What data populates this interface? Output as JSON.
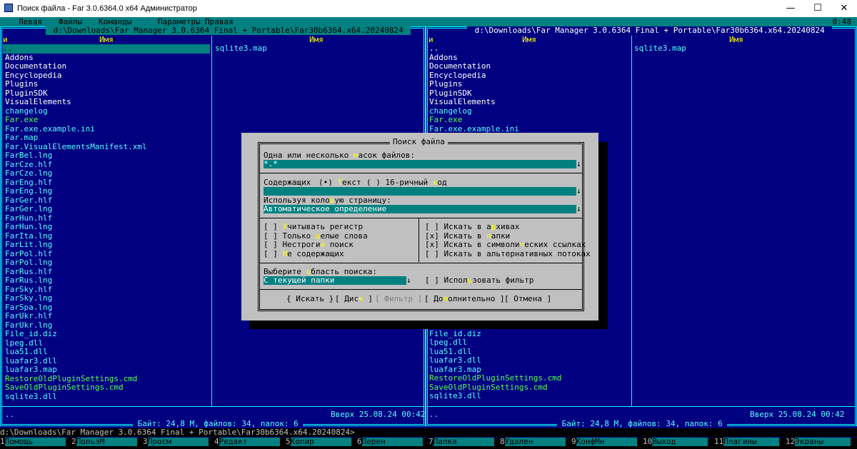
{
  "window": {
    "title": "Поиск файла - Far 3.0.6364.0 x64 Администратор",
    "controls": [
      "—",
      "☐",
      "✕"
    ]
  },
  "menu": {
    "items": [
      "Левая",
      "Файлы",
      "Команды",
      "Параметры",
      "Правая"
    ],
    "clock": "0:48"
  },
  "left_panel": {
    "path": " d:\\Downloads\\Far Manager 3.0.6364 Final + Portable\\Far30b6364.x64.20240824 ",
    "col_headers": [
      "и",
      "Имя",
      "Имя"
    ],
    "col1_selected": "..",
    "col1": [
      {
        "name": "Addons",
        "color": "#ffffff"
      },
      {
        "name": "Documentation",
        "color": "#ffffff"
      },
      {
        "name": "Encyclopedia",
        "color": "#ffffff"
      },
      {
        "name": "Plugins",
        "color": "#ffffff"
      },
      {
        "name": "PluginSDK",
        "color": "#ffffff"
      },
      {
        "name": "VisualElements",
        "color": "#ffffff"
      },
      {
        "name": "changelog",
        "color": "#55ffff"
      },
      {
        "name": "Far.exe",
        "color": "#55ff55"
      },
      {
        "name": "Far.exe.example.ini",
        "color": "#55ffff"
      },
      {
        "name": "Far.map",
        "color": "#55ffff"
      },
      {
        "name": "Far.VisualElementsManifest.xml",
        "color": "#55ffff"
      },
      {
        "name": "FarBel.lng",
        "color": "#55ffff"
      },
      {
        "name": "FarCze.hlf",
        "color": "#55ffff"
      },
      {
        "name": "FarCze.lng",
        "color": "#55ffff"
      },
      {
        "name": "FarEng.hlf",
        "color": "#55ffff"
      },
      {
        "name": "FarEng.lng",
        "color": "#55ffff"
      },
      {
        "name": "FarGer.hlf",
        "color": "#55ffff"
      },
      {
        "name": "FarGer.lng",
        "color": "#55ffff"
      },
      {
        "name": "FarHun.hlf",
        "color": "#55ffff"
      },
      {
        "name": "FarHun.lng",
        "color": "#55ffff"
      },
      {
        "name": "FarIta.lng",
        "color": "#55ffff"
      },
      {
        "name": "FarLit.lng",
        "color": "#55ffff"
      },
      {
        "name": "FarPol.hlf",
        "color": "#55ffff"
      },
      {
        "name": "FarPol.lng",
        "color": "#55ffff"
      },
      {
        "name": "FarRus.hlf",
        "color": "#55ffff"
      },
      {
        "name": "FarRus.lng",
        "color": "#55ffff"
      },
      {
        "name": "FarSky.hlf",
        "color": "#55ffff"
      },
      {
        "name": "FarSky.lng",
        "color": "#55ffff"
      },
      {
        "name": "FarSpa.lng",
        "color": "#55ffff"
      },
      {
        "name": "FarUkr.hlf",
        "color": "#55ffff"
      },
      {
        "name": "FarUkr.lng",
        "color": "#55ffff"
      },
      {
        "name": "File_id.diz",
        "color": "#55ffff"
      },
      {
        "name": "lpeg.dll",
        "color": "#55ffff"
      },
      {
        "name": "lua51.dll",
        "color": "#55ffff"
      },
      {
        "name": "luafar3.dll",
        "color": "#55ffff"
      },
      {
        "name": "luafar3.map",
        "color": "#55ffff"
      },
      {
        "name": "RestoreOldPluginSettings.cmd",
        "color": "#55ff55"
      },
      {
        "name": "SaveOldPluginSettings.cmd",
        "color": "#55ff55"
      },
      {
        "name": "sqlite3.dll",
        "color": "#55ffff"
      }
    ],
    "col2": [
      "sqlite3.map"
    ],
    "status_name": "..",
    "status_info": "Вверх 25.08.24 00:42",
    "info": " Байт: 24,8 М, файлов: 34, папок: 6 "
  },
  "right_panel": {
    "path": " d:\\Downloads\\Far Manager 3.0.6364 Final + Portable\\Far30b6364.x64.20240824 ",
    "col_headers": [
      "и",
      "Имя",
      "Имя"
    ],
    "col1_top": [
      {
        "name": "..",
        "color": "#ffffff"
      },
      {
        "name": "Addons",
        "color": "#ffffff"
      },
      {
        "name": "Documentation",
        "color": "#ffffff"
      },
      {
        "name": "Encyclopedia",
        "color": "#ffffff"
      },
      {
        "name": "Plugins",
        "color": "#ffffff"
      },
      {
        "name": "PluginSDK",
        "color": "#ffffff"
      },
      {
        "name": "VisualElements",
        "color": "#ffffff"
      },
      {
        "name": "changelog",
        "color": "#55ffff"
      },
      {
        "name": "Far.exe",
        "color": "#55ff55"
      },
      {
        "name": "Far.exe.example.ini",
        "color": "#55ffff"
      }
    ],
    "col1_bottom": [
      {
        "name": "FarUkr.lng",
        "color": "#00aaaa"
      },
      {
        "name": "File_id.diz",
        "color": "#55ffff"
      },
      {
        "name": "lpeg.dll",
        "color": "#55ffff"
      },
      {
        "name": "lua51.dll",
        "color": "#55ffff"
      },
      {
        "name": "luafar3.dll",
        "color": "#55ffff"
      },
      {
        "name": "luafar3.map",
        "color": "#55ffff"
      },
      {
        "name": "RestoreOldPluginSettings.cmd",
        "color": "#55ff55"
      },
      {
        "name": "SaveOldPluginSettings.cmd",
        "color": "#55ff55"
      },
      {
        "name": "sqlite3.dll",
        "color": "#55ffff"
      }
    ],
    "col2": [
      "sqlite3.map"
    ],
    "status_name": "..",
    "status_info": "Вверх 25.08.24 00:42",
    "info": " Байт: 24,8 М, файлов: 34, папок: 6 "
  },
  "command_line": "d:\\Downloads\\Far Manager 3.0.6364 Final + Portable\\Far30b6364.x64.20240824>",
  "keybar": [
    {
      "n": "1",
      "label": "Помощь"
    },
    {
      "n": "2",
      "label": "ПользМ"
    },
    {
      "n": "3",
      "label": "Просм"
    },
    {
      "n": "4",
      "label": "Редакт"
    },
    {
      "n": "5",
      "label": "Копир"
    },
    {
      "n": "6",
      "label": "Перен"
    },
    {
      "n": "7",
      "label": "Папка"
    },
    {
      "n": "8",
      "label": "Удален"
    },
    {
      "n": "9",
      "label": "КонфМн"
    },
    {
      "n": "10",
      "label": "Выход"
    },
    {
      "n": "11",
      "label": "Плагины"
    },
    {
      "n": "12",
      "label": "Экраны"
    }
  ],
  "dialog": {
    "title": "Поиск файла",
    "mask_label": {
      "pre": "Одна или несколько ",
      "hot": "м",
      "post": "асок файлов:"
    },
    "mask_value": "*.*",
    "contains_label": "Содержащих",
    "text_radio": {
      "mark": "(•)",
      "pre": " ",
      "hot": "Т",
      "post": "екст"
    },
    "hex_radio": {
      "mark": "( )",
      "pre": " 16-ричный ",
      "hot": "к",
      "post": "од"
    },
    "contains_value": "",
    "codepage_label": {
      "pre": "Используя коло",
      "hot": "в",
      "post": "ую страницу:"
    },
    "codepage_value": "Автоматическое определение",
    "options_left": [
      {
        "mark": "[ ]",
        "pre": " ",
        "hot": "У",
        "post": "читывать регистр"
      },
      {
        "mark": "[ ]",
        "pre": " Только ",
        "hot": "ц",
        "post": "елые слова"
      },
      {
        "mark": "[ ]",
        "pre": " Нестроги",
        "hot": "й",
        "post": " поиск"
      },
      {
        "mark": "[ ]",
        "pre": " ",
        "hot": "Н",
        "post": "е содержащих"
      }
    ],
    "options_right": [
      {
        "mark": "[ ]",
        "pre": " Искать в а",
        "hot": "р",
        "post": "хивах"
      },
      {
        "mark": "[x]",
        "pre": " Искать в ",
        "hot": "п",
        "post": "апки"
      },
      {
        "mark": "[x]",
        "pre": " Искать в символи",
        "hot": "ч",
        "post": "еских ссылках"
      },
      {
        "mark": "[ ]",
        "pre": " Искать в альтернативных потоках",
        "hot": "",
        "post": ""
      }
    ],
    "area_label": {
      "pre": "Выберите ",
      "hot": "о",
      "post": "бласть поиска:"
    },
    "area_value": "С текущей папки",
    "use_filter": {
      "mark": "[ ]",
      "pre": " Испол",
      "hot": "ь",
      "post": "зовать фильтр"
    },
    "buttons": {
      "search": "{ Искать }",
      "drive": {
        "pre": "[ Дис",
        "hot": "к",
        "post": " ]"
      },
      "filter": "[ Фильтр ]",
      "advanced": {
        "pre": "[ До",
        "hot": "п",
        "post": "олнительно ]"
      },
      "cancel": "[ Отмена ]"
    }
  },
  "colors": {
    "panel_bg": "#000080",
    "frame": "#00ffff",
    "selection": "#008080",
    "dialog_bg": "#c0c0c0",
    "hotkey": "#ffff00"
  }
}
